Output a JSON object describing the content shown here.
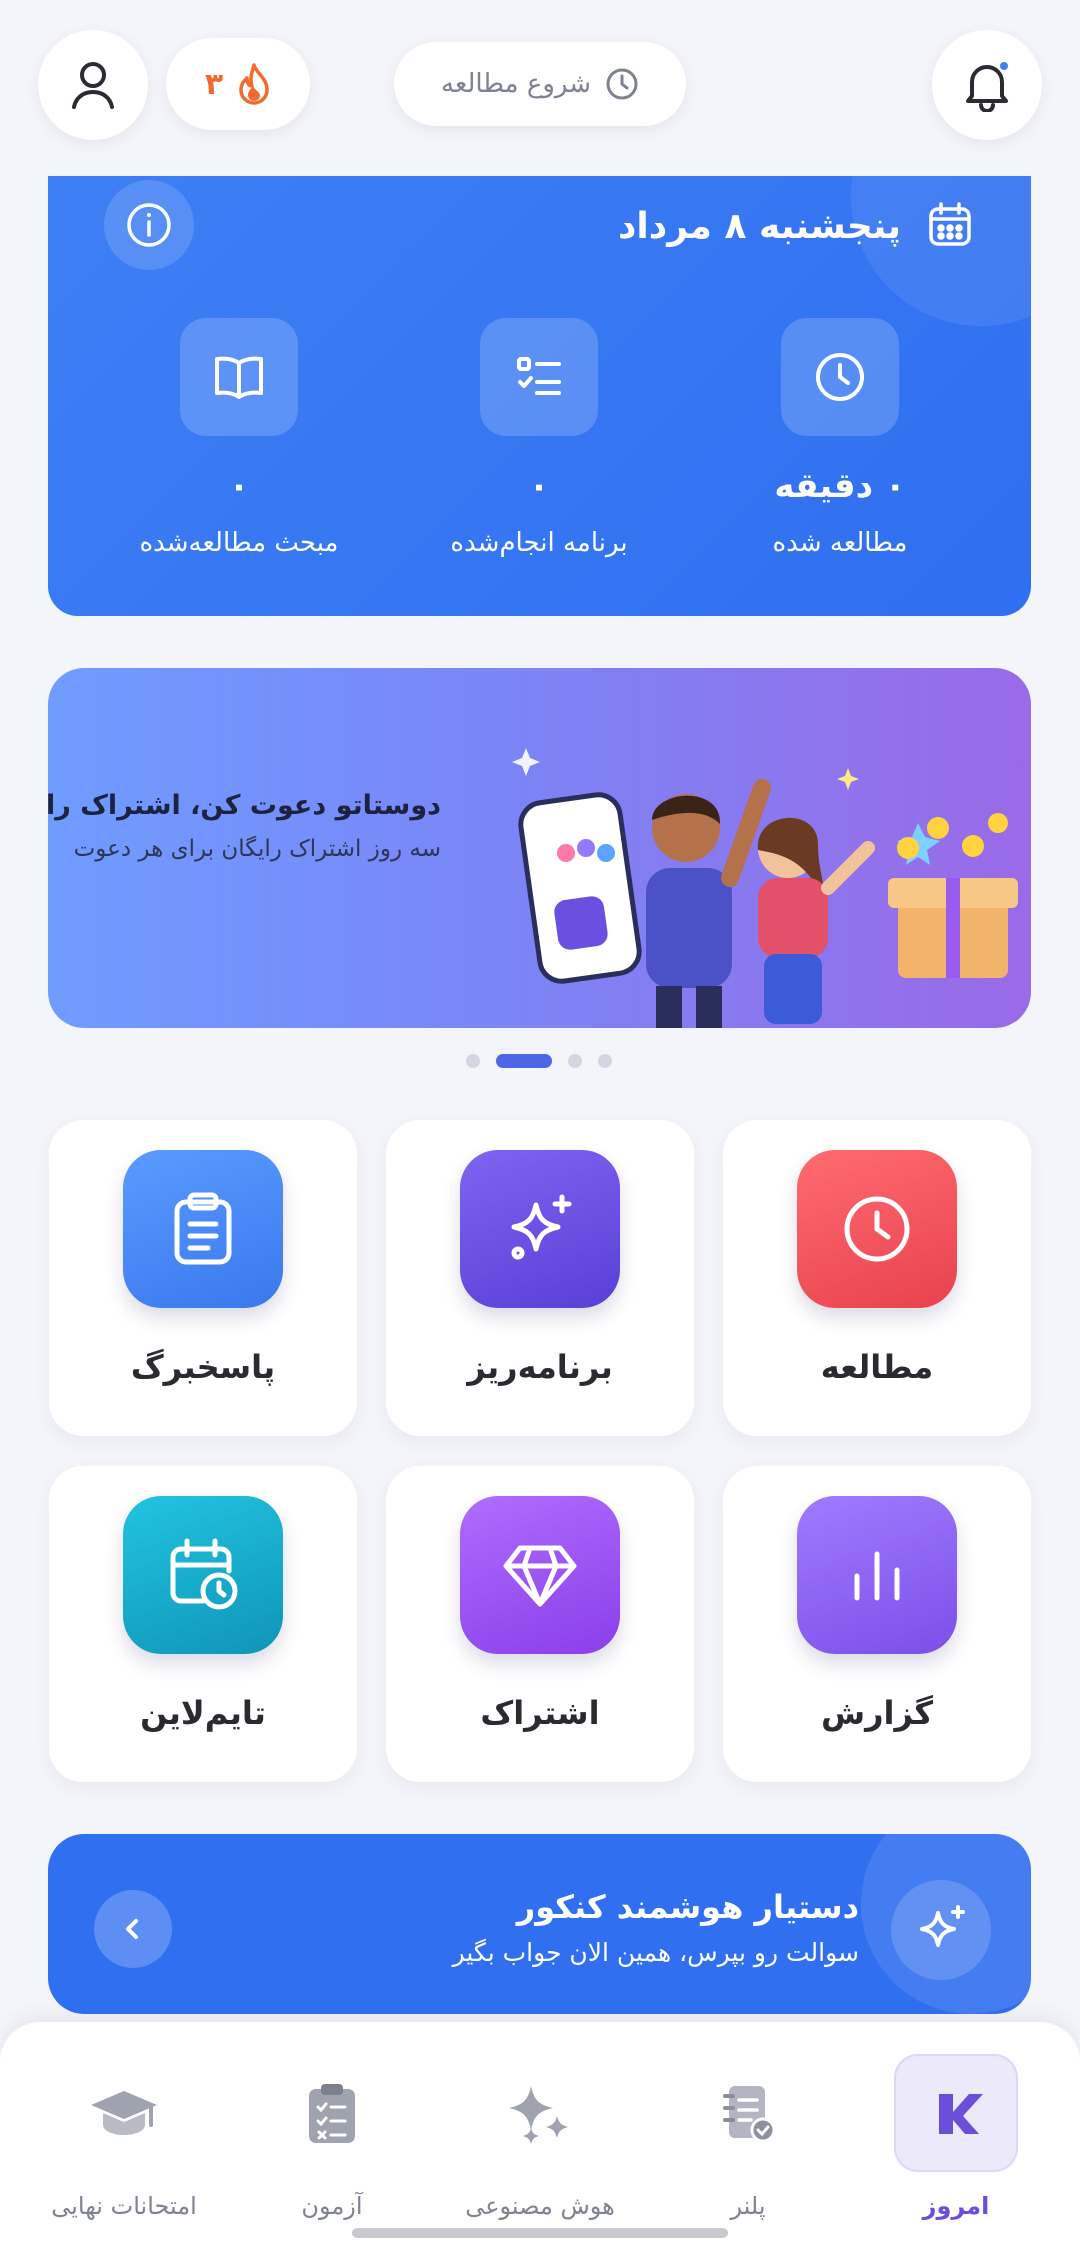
{
  "header": {
    "streak_count": "۳",
    "start_study_label": "شروع مطالعه",
    "icons": [
      "profile-icon",
      "flame-icon",
      "clock-icon",
      "bell-icon"
    ]
  },
  "stats": {
    "date": "پنجشنبه ۸ مرداد",
    "items": [
      {
        "value": "۰ دقیقه",
        "label": "مطالعه شده",
        "icon": "clock-icon"
      },
      {
        "value": "۰",
        "label": "برنامه انجام‌شده",
        "icon": "checklist-icon"
      },
      {
        "value": "۰",
        "label": "مبحث مطالعه‌شده",
        "icon": "book-icon"
      }
    ]
  },
  "banner": {
    "title": "دوستاتو دعوت کن، اشتراک رایگان ب",
    "subtitle": "سه روز اشتراک رایگان برای هر دعوت",
    "active_slide": 2,
    "slide_count": 4
  },
  "tiles": [
    {
      "label": "مطالعه",
      "icon": "clock-icon",
      "color": "#f0505a"
    },
    {
      "label": "برنامه‌ریز",
      "icon": "sparkle-icon",
      "color": "#6a4fe0"
    },
    {
      "label": "پاسخبرگ",
      "icon": "clipboard-icon",
      "color": "#3f84f5"
    },
    {
      "label": "گزارش",
      "icon": "bar-chart-icon",
      "color": "#8b5cf0"
    },
    {
      "label": "اشتراک",
      "icon": "diamond-icon",
      "color": "#9a50ef"
    },
    {
      "label": "تایم‌لاین",
      "icon": "calendar-clock-icon",
      "color": "#1aa7cf"
    }
  ],
  "assistant": {
    "title": "دستیار هوشمند کنکور",
    "subtitle": "سوالت رو بپرس، همین الان جواب بگیر"
  },
  "nav": [
    {
      "label": "امروز",
      "icon": "logo-icon",
      "active": true
    },
    {
      "label": "پلنر",
      "icon": "planner-icon",
      "active": false
    },
    {
      "label": "هوش مصنوعی",
      "icon": "ai-sparkle-icon",
      "active": false
    },
    {
      "label": "آزمون",
      "icon": "exam-clipboard-icon",
      "active": false
    },
    {
      "label": "امتحانات نهایی",
      "icon": "graduation-cap-icon",
      "active": false
    }
  ],
  "colors": {
    "primary_blue": "#2f6ff0",
    "background": "#f4f5fa",
    "accent_purple": "#6b4fd8",
    "streak_orange": "#f26a2e"
  }
}
